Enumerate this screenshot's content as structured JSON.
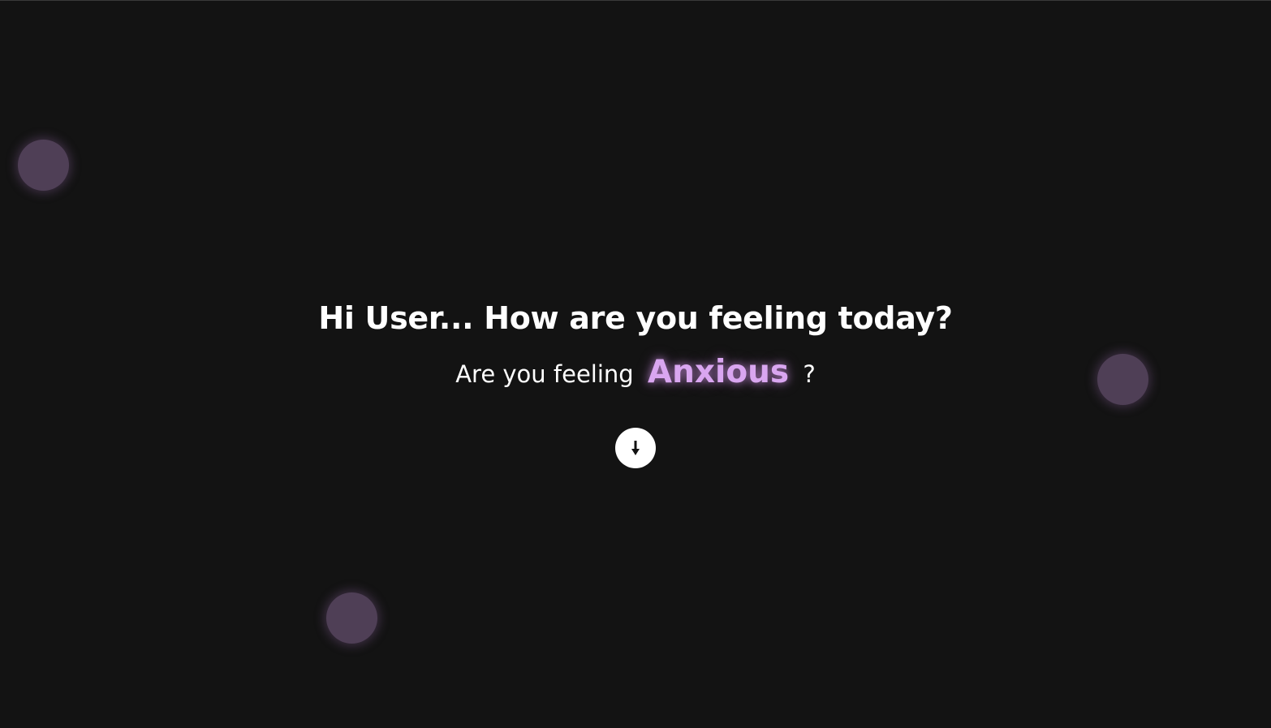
{
  "greeting": {
    "title": "Hi User... How are you feeling today?",
    "question_prefix": "Are you feeling",
    "emotion": "Anxious",
    "question_suffix": "?"
  },
  "scroll_button": {
    "icon": "arrow-down-icon"
  },
  "colors": {
    "background": "#131313",
    "accent": "#d9a6f0",
    "orb": "#4f3f56",
    "text": "#ffffff"
  }
}
